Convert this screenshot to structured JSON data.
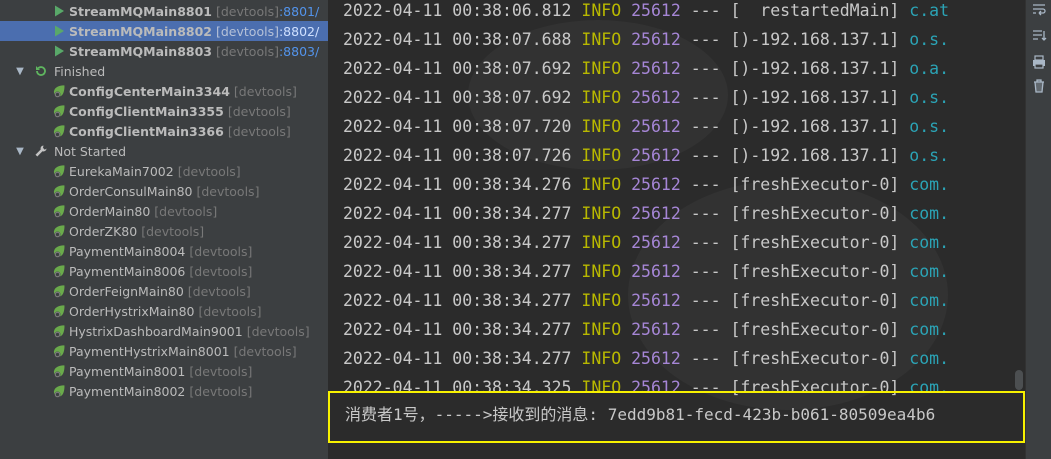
{
  "tree": {
    "items": [
      {
        "kind": "running",
        "name": "StreamMQMain8801",
        "tag": "[devtools]",
        "port": ":8801/",
        "bold": true,
        "selected": false
      },
      {
        "kind": "running",
        "name": "StreamMQMain8802",
        "tag": "[devtools]",
        "port": ":8802/",
        "bold": true,
        "selected": true
      },
      {
        "kind": "running",
        "name": "StreamMQMain8803",
        "tag": "[devtools]",
        "port": ":8803/",
        "bold": true,
        "selected": false
      },
      {
        "kind": "group",
        "name": "Finished",
        "tag": "",
        "port": ""
      },
      {
        "kind": "finished",
        "name": "ConfigCenterMain3344",
        "tag": "[devtools]",
        "port": "",
        "bold": true
      },
      {
        "kind": "finished",
        "name": "ConfigClientMain3355",
        "tag": "[devtools]",
        "port": "",
        "bold": true
      },
      {
        "kind": "finished",
        "name": "ConfigClientMain3366",
        "tag": "[devtools]",
        "port": "",
        "bold": true
      },
      {
        "kind": "group",
        "name": "Not Started",
        "tag": "",
        "port": ""
      },
      {
        "kind": "idle",
        "name": "EurekaMain7002",
        "tag": "[devtools]",
        "port": ""
      },
      {
        "kind": "idle",
        "name": "OrderConsulMain80",
        "tag": "[devtools]",
        "port": ""
      },
      {
        "kind": "idle",
        "name": "OrderMain80",
        "tag": "[devtools]",
        "port": ""
      },
      {
        "kind": "idle",
        "name": "OrderZK80",
        "tag": "[devtools]",
        "port": ""
      },
      {
        "kind": "idle",
        "name": "PaymentMain8004",
        "tag": "[devtools]",
        "port": ""
      },
      {
        "kind": "idle",
        "name": "PaymentMain8006",
        "tag": "[devtools]",
        "port": ""
      },
      {
        "kind": "idle",
        "name": "OrderFeignMain80",
        "tag": "[devtools]",
        "port": ""
      },
      {
        "kind": "idle",
        "name": "OrderHystrixMain80",
        "tag": "[devtools]",
        "port": ""
      },
      {
        "kind": "idle",
        "name": "HystrixDashboardMain9001",
        "tag": "[devtools]",
        "port": ""
      },
      {
        "kind": "idle",
        "name": "PaymentHystrixMain8001",
        "tag": "[devtools]",
        "port": ""
      },
      {
        "kind": "idle",
        "name": "PaymentMain8001",
        "tag": "[devtools]",
        "port": ""
      },
      {
        "kind": "idle",
        "name": "PaymentMain8002",
        "tag": "[devtools]",
        "port": ""
      }
    ]
  },
  "console": {
    "lines": [
      {
        "ts": "2022-04-11 00:38:06.812",
        "level": "INFO",
        "pid": "25612",
        "sep": "---",
        "thread": "[  restartedMain]",
        "logger": "c.at"
      },
      {
        "ts": "2022-04-11 00:38:07.688",
        "level": "INFO",
        "pid": "25612",
        "sep": "---",
        "thread": "[)-192.168.137.1]",
        "logger": "o.s."
      },
      {
        "ts": "2022-04-11 00:38:07.692",
        "level": "INFO",
        "pid": "25612",
        "sep": "---",
        "thread": "[)-192.168.137.1]",
        "logger": "o.a."
      },
      {
        "ts": "2022-04-11 00:38:07.692",
        "level": "INFO",
        "pid": "25612",
        "sep": "---",
        "thread": "[)-192.168.137.1]",
        "logger": "o.s."
      },
      {
        "ts": "2022-04-11 00:38:07.720",
        "level": "INFO",
        "pid": "25612",
        "sep": "---",
        "thread": "[)-192.168.137.1]",
        "logger": "o.s."
      },
      {
        "ts": "2022-04-11 00:38:07.726",
        "level": "INFO",
        "pid": "25612",
        "sep": "---",
        "thread": "[)-192.168.137.1]",
        "logger": "o.s."
      },
      {
        "ts": "2022-04-11 00:38:34.276",
        "level": "INFO",
        "pid": "25612",
        "sep": "---",
        "thread": "[freshExecutor-0]",
        "logger": "com."
      },
      {
        "ts": "2022-04-11 00:38:34.277",
        "level": "INFO",
        "pid": "25612",
        "sep": "---",
        "thread": "[freshExecutor-0]",
        "logger": "com."
      },
      {
        "ts": "2022-04-11 00:38:34.277",
        "level": "INFO",
        "pid": "25612",
        "sep": "---",
        "thread": "[freshExecutor-0]",
        "logger": "com."
      },
      {
        "ts": "2022-04-11 00:38:34.277",
        "level": "INFO",
        "pid": "25612",
        "sep": "---",
        "thread": "[freshExecutor-0]",
        "logger": "com."
      },
      {
        "ts": "2022-04-11 00:38:34.277",
        "level": "INFO",
        "pid": "25612",
        "sep": "---",
        "thread": "[freshExecutor-0]",
        "logger": "com."
      },
      {
        "ts": "2022-04-11 00:38:34.277",
        "level": "INFO",
        "pid": "25612",
        "sep": "---",
        "thread": "[freshExecutor-0]",
        "logger": "com."
      },
      {
        "ts": "2022-04-11 00:38:34.277",
        "level": "INFO",
        "pid": "25612",
        "sep": "---",
        "thread": "[freshExecutor-0]",
        "logger": "com."
      },
      {
        "ts": "2022-04-11 00:38:34.325",
        "level": "INFO",
        "pid": "25612",
        "sep": "---",
        "thread": "[freshExecutor-0]",
        "logger": "com."
      }
    ],
    "message": "消费者1号，----->接收到的消息: 7edd9b81-fecd-423b-b061-80509ea4b6"
  },
  "colors": {
    "highlight_border": "#f7f100",
    "selected_row": "#4b6eaf",
    "info_level": "#b8b800",
    "pid": "#a686d6",
    "logger": "#2ba3b5"
  },
  "toolbar": {
    "icons": [
      "soft-wrap-icon",
      "scroll-to-end-icon",
      "print-icon",
      "clear-icon"
    ]
  }
}
